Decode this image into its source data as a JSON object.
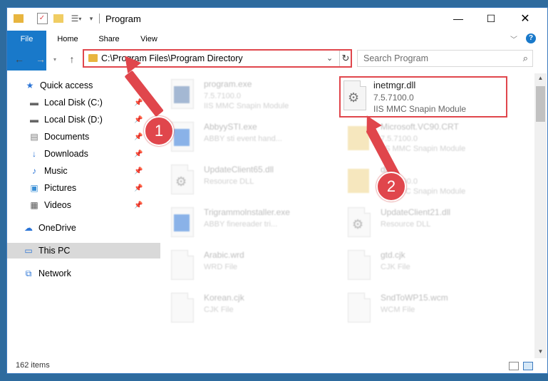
{
  "title_bar": {
    "title": "Program"
  },
  "ribbon": {
    "tabs": [
      "File",
      "Home",
      "Share",
      "View"
    ],
    "help": "?"
  },
  "address_bar": {
    "path": "C:\\Program Files\\Program Directory"
  },
  "search": {
    "placeholder": "Search Program"
  },
  "sidebar": {
    "quick_access": "Quick access",
    "items": [
      "Local Disk (C:)",
      "Local Disk (D:)",
      "Documents",
      "Downloads",
      "Music",
      "Pictures",
      "Videos"
    ],
    "onedrive": "OneDrive",
    "this_pc": "This PC",
    "network": "Network"
  },
  "files": [
    {
      "name": "program.exe",
      "line2": "7.5.7100.0",
      "line3": "IIS MMC Snapin Module"
    },
    {
      "name": "inetmgr.dll",
      "line2": "7.5.7100.0",
      "line3": "IIS MMC Snapin Module"
    },
    {
      "name": "AbbyySTI.exe",
      "line2": "ABBY sti event hand...",
      "line3": ""
    },
    {
      "name": "Microsoft.VC90.CRT",
      "line2": "7.5.7100.0",
      "line3": "IIS MMC Snapin Module"
    },
    {
      "name": "UpdateClient65.dll",
      "line2": "Resource DLL",
      "line3": ""
    },
    {
      "name": "dll",
      "line2": "7.5.7100.0",
      "line3": "IIS MMC Snapin Module"
    },
    {
      "name": "Trigrammolnstaller.exe",
      "line2": "ABBY finereader tri...",
      "line3": ""
    },
    {
      "name": "UpdateClient21.dll",
      "line2": "Resource DLL",
      "line3": ""
    },
    {
      "name": "Arabic.wrd",
      "line2": "WRD File",
      "line3": ""
    },
    {
      "name": "gtd.cjk",
      "line2": "CJK File",
      "line3": ""
    },
    {
      "name": "Korean.cjk",
      "line2": "CJK File",
      "line3": ""
    },
    {
      "name": "SndToWP15.wcm",
      "line2": "WCM File",
      "line3": ""
    }
  ],
  "status": {
    "count": "162 items"
  },
  "annotations": [
    "1",
    "2"
  ],
  "colors": {
    "highlight": "#e0464c",
    "accent": "#1979ca"
  }
}
